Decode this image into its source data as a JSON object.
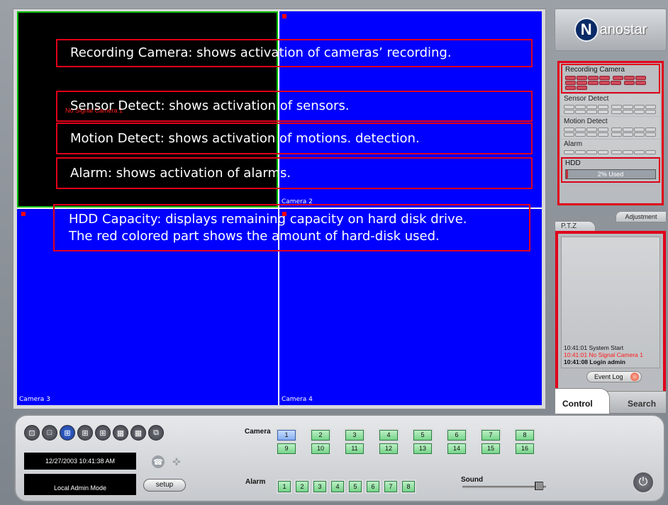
{
  "cameras": [
    {
      "label": "",
      "status": "No Signal Camera 1"
    },
    {
      "label": "Camera 2"
    },
    {
      "label": "Camera 3"
    },
    {
      "label": "Camera 4"
    }
  ],
  "callouts": [
    "Recording Camera: shows activation of cameras’ recording.",
    "Sensor Detect: shows activation of sensors.",
    "Motion Detect: shows activation of motions. detection.",
    "Alarm: shows activation of alarms.",
    "HDD Capacity: displays remaining capacity on hard disk drive.",
    "The red colored part shows the amount of hard-disk used."
  ],
  "logo": {
    "text": "anostar",
    "mark": "N"
  },
  "status_panel": {
    "recording_title": "Recording Camera",
    "sensor_title": "Sensor Detect",
    "motion_title": "Motion Detect",
    "alarm_title": "Alarm",
    "hdd_title": "HDD",
    "hdd_used_text": "2% Used",
    "hdd_used_fraction": 0.02,
    "adjustment_label": "Adjustment",
    "ptz_label": "P.T.Z"
  },
  "event_log": {
    "lines": [
      {
        "text": "10:41:01 System Start",
        "style": "normal"
      },
      {
        "text": "10:41:01 No Signal Camera 1",
        "style": "red"
      },
      {
        "text": "10:41:08 Login admin",
        "style": "bold"
      }
    ],
    "button_label": "Event Log"
  },
  "tabs": {
    "control": "Control",
    "search": "Search"
  },
  "bottom": {
    "datetime": "12/27/2003 10:41:38 AM",
    "mode": "Local Admin Mode",
    "setup_label": "setup",
    "camera_label": "Camera",
    "alarm_label": "Alarm",
    "sound_label": "Sound",
    "camera_buttons": [
      "1",
      "2",
      "3",
      "4",
      "5",
      "6",
      "7",
      "8",
      "9",
      "10",
      "11",
      "12",
      "13",
      "14",
      "15",
      "16"
    ],
    "alarm_buttons": [
      "1",
      "2",
      "3",
      "4",
      "5",
      "6",
      "7",
      "8"
    ]
  },
  "colors": {
    "accent_red": "#e0001a",
    "video_blue": "#0000ff",
    "button_green": "#76d48a"
  },
  "icons": [
    "single-view-icon",
    "quad-view-icon",
    "nine-view-icon",
    "sixteen-view-icon",
    "phone-icon",
    "ptz-icon",
    "power-icon"
  ]
}
